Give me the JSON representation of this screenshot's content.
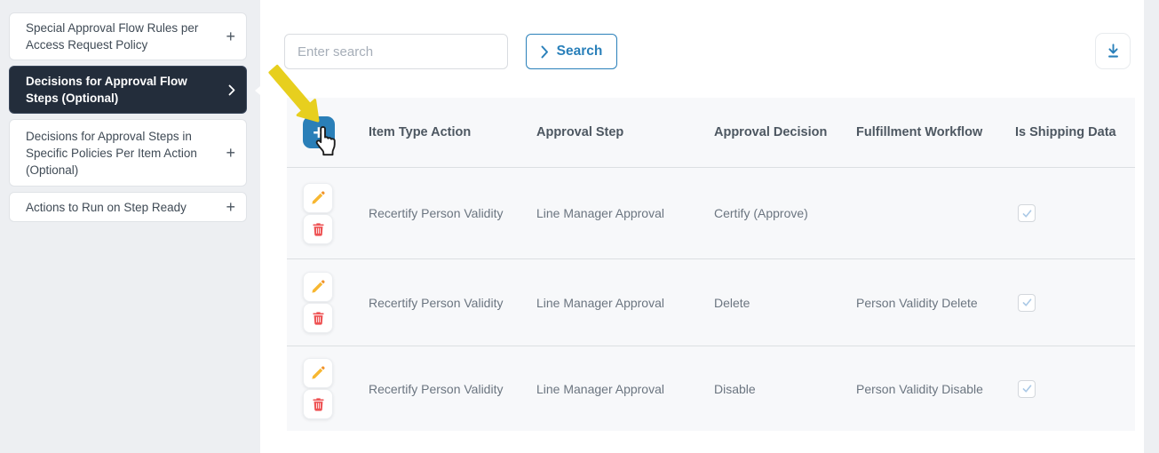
{
  "sidebar": {
    "items": [
      {
        "label": "Special Approval Flow Rules per Access Request Policy",
        "expand_icon": "+",
        "selected": false
      },
      {
        "label": "Decisions for Approval Flow Steps (Optional)",
        "expand_icon": "chevron-right",
        "selected": true
      },
      {
        "label": "Decisions for Approval Steps in Specific Policies Per Item Action (Optional)",
        "expand_icon": "+",
        "selected": false
      },
      {
        "label": "Actions to Run on Step Ready",
        "expand_icon": "+",
        "selected": false
      }
    ]
  },
  "toolbar": {
    "search_placeholder": "Enter search",
    "search_button_label": "Search"
  },
  "table": {
    "columns": [
      "Item Type Action",
      "Approval Step",
      "Approval Decision",
      "Fulfillment Workflow",
      "Is Shipping Data"
    ],
    "rows": [
      {
        "item_type_action": "Recertify Person Validity",
        "approval_step": "Line Manager Approval",
        "approval_decision": "Certify (Approve)",
        "fulfillment_workflow": "",
        "is_shipping_data_checked": true
      },
      {
        "item_type_action": "Recertify Person Validity",
        "approval_step": "Line Manager Approval",
        "approval_decision": "Delete",
        "fulfillment_workflow": "Person Validity Delete",
        "is_shipping_data_checked": true
      },
      {
        "item_type_action": "Recertify Person Validity",
        "approval_step": "Line Manager Approval",
        "approval_decision": "Disable",
        "fulfillment_workflow": "Person Validity Disable",
        "is_shipping_data_checked": true
      }
    ]
  },
  "icons": {
    "add": "+",
    "expand_plus": "+",
    "selected_chevron": "chevron-right",
    "search_chevron": "chevron-right",
    "edit": "pencil",
    "delete": "trash",
    "download": "download-arrow",
    "checkbox_check": "check",
    "annotation_arrow": "yellow-arrow",
    "annotation_cursor": "hand-pointer"
  },
  "colors": {
    "accent_blue": "#2a80ba",
    "selected_nav_bg": "#232d3b",
    "edit_orange": "#f5a42c",
    "delete_red": "#ee5253",
    "arrow_yellow": "#e7cf1e",
    "table_bg": "#f7f8fa",
    "check_blue": "#abc9e6"
  }
}
